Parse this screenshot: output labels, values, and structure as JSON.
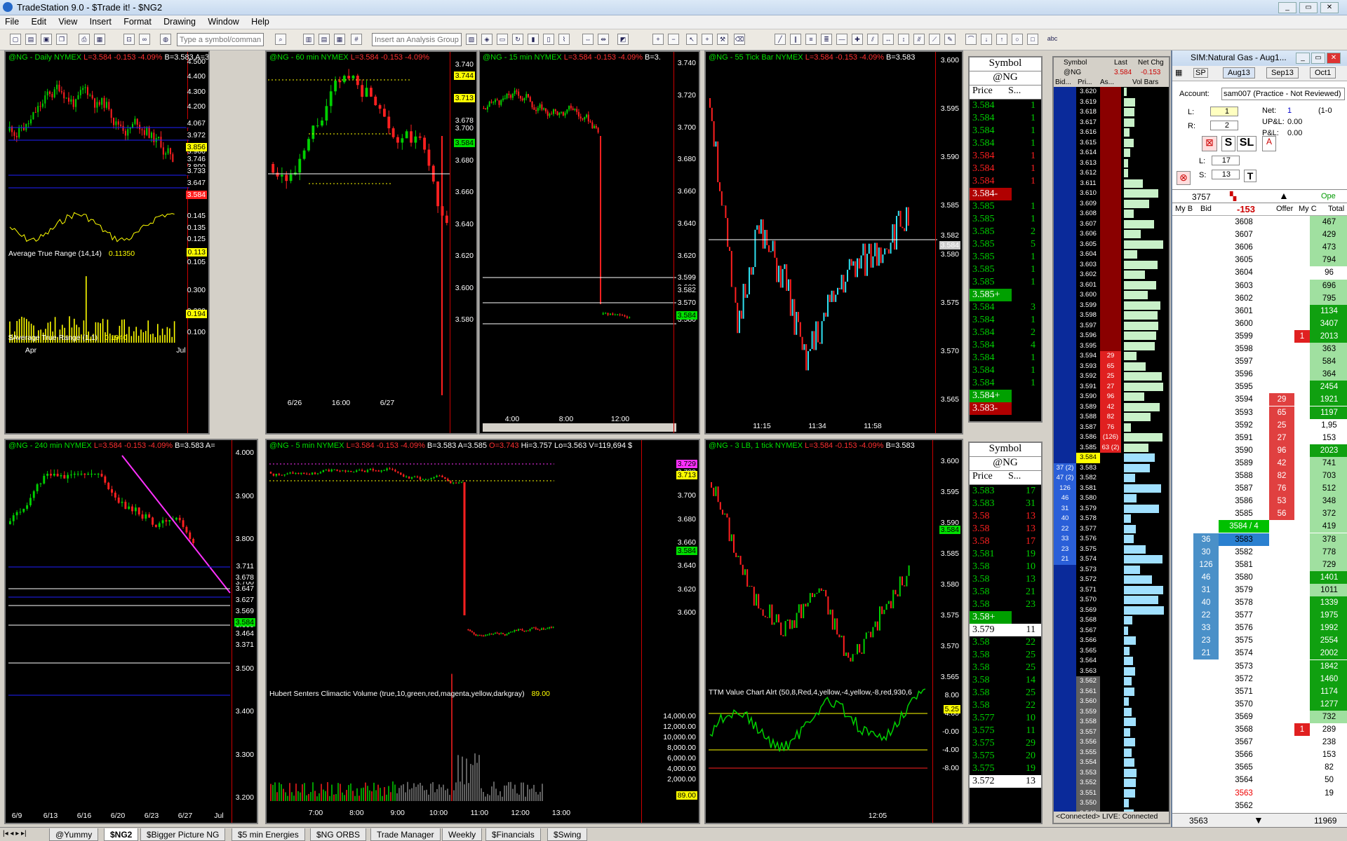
{
  "app": {
    "title": "TradeStation 9.0 - $Trade it! - $NG2"
  },
  "menu": [
    "File",
    "Edit",
    "View",
    "Insert",
    "Format",
    "Drawing",
    "Window",
    "Help"
  ],
  "toolbar": {
    "symbol_placeholder": "Type a symbol/command",
    "analysis_placeholder": "Insert an Analysis Group",
    "drawing_text": "abc"
  },
  "charts": {
    "daily": {
      "title": "@NG - Daily",
      "exchange": "NYMEX",
      "last": "L=3.584",
      "chg": "-0.153",
      "pct": "-4.09%",
      "bid": "B=3.583",
      "ask": "A=3.5",
      "ticks": [
        "4.500",
        "4.400",
        "4.300",
        "4.200",
        "4.100",
        "4.000",
        "3.900",
        "3.800",
        "3.700"
      ],
      "labels": [
        "4.067",
        "3.972",
        "3.856",
        "3.746",
        "3.733",
        "3.647",
        "3.584"
      ],
      "ind1": {
        "name": "Average True Range (14,14)",
        "value": "0.11350",
        "ticks": [
          "0.145",
          "0.135",
          "0.125",
          "0.115",
          "0.105"
        ],
        "last": "0.113"
      },
      "ind2": {
        "name": "$Average True Range (1,1)",
        "value": "0.1940",
        "ticks": [
          "0.300",
          "0.200",
          "0.100"
        ],
        "last": "0.194"
      },
      "xticks": [
        "Apr",
        "Jul"
      ]
    },
    "m60": {
      "title": "@NG - 60 min",
      "exchange": "NYMEX",
      "last": "L=3.584",
      "chg": "-0.153",
      "pct": "-4.09%",
      "ticks": [
        "3.740",
        "3.720",
        "3.700",
        "3.680",
        "3.660",
        "3.640",
        "3.620",
        "3.600",
        "3.580"
      ],
      "labels": [
        "3.744",
        "3.713",
        "3.678",
        "3.584"
      ],
      "xticks": [
        "6/26",
        "16:00",
        "6/27"
      ]
    },
    "m15": {
      "title": "@NG - 15 min",
      "exchange": "NYMEX",
      "last": "L=3.584",
      "chg": "-0.153",
      "pct": "-4.09%",
      "bid": "B=3.",
      "ticks": [
        "3.740",
        "3.720",
        "3.700",
        "3.680",
        "3.660",
        "3.640",
        "3.620",
        "3.600",
        "3.580"
      ],
      "labels": [
        "3.599",
        "3.582",
        "3.570",
        "3.584"
      ],
      "xticks": [
        "4:00",
        "8:00",
        "12:00"
      ]
    },
    "t55": {
      "title": "@NG - 55 Tick Bar",
      "exchange": "NYMEX",
      "last": "L=3.584",
      "chg": "-0.153",
      "pct": "-4.09%",
      "bid": "B=3.583",
      "ticks": [
        "3.600",
        "3.595",
        "3.590",
        "3.585",
        "3.580",
        "3.575",
        "3.570",
        "3.565"
      ],
      "labels": [
        "3.582",
        "3.584"
      ],
      "xticks": [
        "11:15",
        "11:34",
        "11:58"
      ]
    },
    "m240": {
      "title": "@NG - 240 min",
      "exchange": "NYMEX",
      "last": "L=3.584",
      "chg": "-0.153",
      "pct": "-4.09%",
      "bid": "B=3.583",
      "ask": "A=",
      "ticks": [
        "4.000",
        "3.900",
        "3.800",
        "3.700",
        "3.600",
        "3.500",
        "3.400",
        "3.300",
        "3.200"
      ],
      "labels": [
        "3.711",
        "3.678",
        "3.647",
        "3.627",
        "3.569",
        "3.584",
        "3.464",
        "3.371"
      ],
      "xticks": [
        "6/9",
        "6/13",
        "6/16",
        "6/20",
        "6/23",
        "6/27",
        "Jul"
      ]
    },
    "m5": {
      "title": "@NG - 5 min",
      "exchange": "NYMEX",
      "last": "L=3.584",
      "chg": "-0.153",
      "pct": "-4.09%",
      "bid": "B=3.583",
      "ask": "A=3.585",
      "open": "O=3.743",
      "hi": "Hi=3.757",
      "lo": "Lo=3.563",
      "vol": "V=119,694",
      "extra": "$",
      "ticks": [
        "3.720",
        "3.700",
        "3.680",
        "3.660",
        "3.640",
        "3.620",
        "3.600"
      ],
      "labels": [
        "3.729",
        "3.713",
        "3.584"
      ],
      "ind": {
        "name": "Hubert Senters Climactic Volume (true,10,green,red,magenta,yellow,darkgray)",
        "value": "89.00",
        "ticks": [
          "14,000.00",
          "12,000.00",
          "10,000.00",
          "8,000.00",
          "6,000.00",
          "4,000.00",
          "2,000.00"
        ],
        "last": "89.00"
      },
      "xticks": [
        "7:00",
        "8:00",
        "9:00",
        "10:00",
        "11:00",
        "12:00",
        "13:00"
      ]
    },
    "lb3": {
      "title": "@NG - 3 LB, 1 tick",
      "exchange": "NYMEX",
      "last": "L=3.584",
      "chg": "-0.153",
      "pct": "-4.09%",
      "bid": "B=3.583",
      "ticks": [
        "3.600",
        "3.595",
        "3.590",
        "3.585",
        "3.580",
        "3.575",
        "3.570",
        "3.565"
      ],
      "labels": [
        "3.584"
      ],
      "ind": {
        "name": "TTM Value Chart Alrt (50,8,Red,4,yellow,-4,yellow,-8,red,930,6",
        "ticks": [
          "8.00",
          "4.00",
          "-0.00",
          "-4.00",
          "-8.00"
        ],
        "last": "5.25"
      },
      "xticks": [
        "12:05"
      ]
    }
  },
  "ladder_top": {
    "symbol_label": "Symbol",
    "symbol": "@NG",
    "price_label": "Price",
    "size_label": "S...",
    "rows": [
      {
        "p": "3.584",
        "s": "1",
        "c": "g"
      },
      {
        "p": "3.584",
        "s": "1",
        "c": "g"
      },
      {
        "p": "3.584",
        "s": "1",
        "c": "g"
      },
      {
        "p": "3.584",
        "s": "1",
        "c": "g"
      },
      {
        "p": "3.584",
        "s": "1",
        "c": "r"
      },
      {
        "p": "3.584",
        "s": "1",
        "c": "r"
      },
      {
        "p": "3.584",
        "s": "1",
        "c": "r"
      },
      {
        "p": "3.584-",
        "s": "1",
        "c": "hlr"
      },
      {
        "p": "3.585",
        "s": "1",
        "c": "g"
      },
      {
        "p": "3.585",
        "s": "1",
        "c": "g"
      },
      {
        "p": "3.585",
        "s": "2",
        "c": "g"
      },
      {
        "p": "3.585",
        "s": "5",
        "c": "g"
      },
      {
        "p": "3.585",
        "s": "1",
        "c": "g"
      },
      {
        "p": "3.585",
        "s": "1",
        "c": "g"
      },
      {
        "p": "3.585",
        "s": "1",
        "c": "g"
      },
      {
        "p": "3.585+",
        "s": "1",
        "c": "hlg"
      },
      {
        "p": "3.584",
        "s": "3",
        "c": "g"
      },
      {
        "p": "3.584",
        "s": "1",
        "c": "g"
      },
      {
        "p": "3.584",
        "s": "2",
        "c": "g"
      },
      {
        "p": "3.584",
        "s": "4",
        "c": "g"
      },
      {
        "p": "3.584",
        "s": "1",
        "c": "g"
      },
      {
        "p": "3.584",
        "s": "1",
        "c": "g"
      },
      {
        "p": "3.584",
        "s": "1",
        "c": "g"
      },
      {
        "p": "3.584+",
        "s": "1",
        "c": "hlg"
      },
      {
        "p": "3.583-",
        "s": "1",
        "c": "hlr"
      }
    ]
  },
  "ladder_bot": {
    "symbol_label": "Symbol",
    "symbol": "@NG",
    "price_label": "Price",
    "size_label": "S...",
    "rows": [
      {
        "p": "3.583",
        "s": "17",
        "c": "g"
      },
      {
        "p": "3.583",
        "s": "31",
        "c": "g"
      },
      {
        "p": "3.58",
        "s": "13",
        "c": "r"
      },
      {
        "p": "3.58",
        "s": "13",
        "c": "r"
      },
      {
        "p": "3.58",
        "s": "17",
        "c": "r"
      },
      {
        "p": "3.581",
        "s": "19",
        "c": "g"
      },
      {
        "p": "3.58",
        "s": "10",
        "c": "g"
      },
      {
        "p": "3.58",
        "s": "13",
        "c": "g"
      },
      {
        "p": "3.58",
        "s": "21",
        "c": "g"
      },
      {
        "p": "3.58",
        "s": "23",
        "c": "g"
      },
      {
        "p": "3.58+",
        "s": "18",
        "c": "hlg"
      },
      {
        "p": "3.579",
        "s": "11",
        "c": "hlw"
      },
      {
        "p": "3.58",
        "s": "22",
        "c": "g"
      },
      {
        "p": "3.58",
        "s": "25",
        "c": "g"
      },
      {
        "p": "3.58",
        "s": "25",
        "c": "g"
      },
      {
        "p": "3.58",
        "s": "14",
        "c": "g"
      },
      {
        "p": "3.58",
        "s": "25",
        "c": "g"
      },
      {
        "p": "3.58",
        "s": "22",
        "c": "g"
      },
      {
        "p": "3.577",
        "s": "10",
        "c": "g"
      },
      {
        "p": "3.575",
        "s": "11",
        "c": "g"
      },
      {
        "p": "3.575",
        "s": "29",
        "c": "g"
      },
      {
        "p": "3.575",
        "s": "20",
        "c": "g"
      },
      {
        "p": "3.575",
        "s": "19",
        "c": "g"
      },
      {
        "p": "3.572",
        "s": "13",
        "c": "hlw"
      }
    ]
  },
  "volbars": {
    "headers": [
      "Symbol",
      "Last",
      "Net Chg"
    ],
    "symbol": "@NG",
    "last": "3.584",
    "chg": "-0.153",
    "sub": [
      "Bid...",
      "Pri...",
      "As...",
      "Vol Bars"
    ],
    "prices": [
      "3.620",
      "3.619",
      "3.618",
      "3.617",
      "3.616",
      "3.615",
      "3.614",
      "3.613",
      "3.612",
      "3.611",
      "3.610",
      "3.609",
      "3.608",
      "3.607",
      "3.606",
      "3.605",
      "3.604",
      "3.603",
      "3.602",
      "3.601",
      "3.600",
      "3.599",
      "3.598",
      "3.597",
      "3.596",
      "3.595",
      "3.594",
      "3.593",
      "3.592",
      "3.591",
      "3.590",
      "3.589",
      "3.588",
      "3.587",
      "3.586",
      "3.585",
      "3.584",
      "3.583",
      "3.582",
      "3.581",
      "3.580",
      "3.579",
      "3.578",
      "3.577",
      "3.576",
      "3.575",
      "3.574",
      "3.573",
      "3.572",
      "3.571",
      "3.570",
      "3.569",
      "3.568",
      "3.567",
      "3.566",
      "3.565",
      "3.564",
      "3.563",
      "3.562",
      "3.561",
      "3.560",
      "3.559",
      "3.558",
      "3.557",
      "3.556",
      "3.555",
      "3.554",
      "3.553",
      "3.552",
      "3.551",
      "3.550",
      "3.549"
    ],
    "asks": {
      "3.594": "29",
      "3.593": "65",
      "3.592": "25",
      "3.591": "27",
      "3.590": "96",
      "3.589": "42",
      "3.588": "82",
      "3.587": "76",
      "3.586": "(126)",
      "3.585": "63 (2)"
    },
    "bids": {
      "3.583": "37 (2)",
      "3.582": "47 (2)",
      "3.581": "126",
      "3.580": "46",
      "3.579": "31",
      "3.578": "40",
      "3.577": "22",
      "3.576": "33",
      "3.575": "23",
      "3.574": "21"
    },
    "status": "<Connected> LIVE: Connected"
  },
  "dom": {
    "title": "SIM:Natural Gas - Aug1...",
    "sp": "SP",
    "months": [
      "Aug13",
      "Sep13",
      "Oct1"
    ],
    "account_label": "Account:",
    "account": "sam007 (Practice - Not Reviewed)",
    "l_label": "L:",
    "l_val": "1",
    "r_label": "R:",
    "r_val": "2",
    "net_label": "Net:",
    "net": "1",
    "net2": "(1-0",
    "upl_label": "UP&L:",
    "upl": "0.00",
    "pl_label": "P&L:",
    "pl": "0.00",
    "s_btn": "S",
    "sl_btn": "SL",
    "l2_label": "L:",
    "l2": "17",
    "s2_label": "S:",
    "s2": "13",
    "t_btn": "T",
    "qty": "3757",
    "open_label": "Ope",
    "colhdr": [
      "My B",
      "Bid",
      "-153",
      "Offer",
      "My C",
      "Total"
    ],
    "rows": [
      {
        "p": "3608",
        "t": "467"
      },
      {
        "p": "3607",
        "t": "429"
      },
      {
        "p": "3606",
        "t": "473"
      },
      {
        "p": "3605",
        "t": "794"
      },
      {
        "p": "3604",
        "t": "96"
      },
      {
        "p": "3603",
        "t": "696"
      },
      {
        "p": "3602",
        "t": "795"
      },
      {
        "p": "3601",
        "t": "1134"
      },
      {
        "p": "3600",
        "t": "3407"
      },
      {
        "p": "3599",
        "t": "2013",
        "myo": "1"
      },
      {
        "p": "3598",
        "t": "363"
      },
      {
        "p": "3597",
        "t": "584"
      },
      {
        "p": "3596",
        "t": "364"
      },
      {
        "p": "3595",
        "t": "2454"
      },
      {
        "p": "3594",
        "o": "29",
        "t": "1921"
      },
      {
        "p": "3593",
        "o": "65",
        "t": "1197"
      },
      {
        "p": "3592",
        "o": "25",
        "t": "1,95"
      },
      {
        "p": "3591",
        "o": "27",
        "t": "153"
      },
      {
        "p": "3590",
        "o": "96",
        "t": "2023"
      },
      {
        "p": "3589",
        "o": "42",
        "t": "741"
      },
      {
        "p": "3588",
        "o": "82",
        "t": "703"
      },
      {
        "p": "3587",
        "o": "76",
        "t": "512"
      },
      {
        "p": "3586",
        "o": "53",
        "t": "348"
      },
      {
        "p": "3585",
        "o": "56",
        "t": "372"
      },
      {
        "p": "3584 / 4",
        "t": "419",
        "last": true
      },
      {
        "p": "3583",
        "b": "36",
        "t": "378"
      },
      {
        "p": "3582",
        "b": "30",
        "t": "778"
      },
      {
        "p": "3581",
        "b": "126",
        "t": "729"
      },
      {
        "p": "3580",
        "b": "46",
        "t": "1401"
      },
      {
        "p": "3579",
        "b": "31",
        "t": "1011"
      },
      {
        "p": "3578",
        "b": "40",
        "t": "1339"
      },
      {
        "p": "3577",
        "b": "22",
        "t": "1975"
      },
      {
        "p": "3576",
        "b": "33",
        "t": "1992"
      },
      {
        "p": "3575",
        "b": "23",
        "t": "2554"
      },
      {
        "p": "3574",
        "b": "21",
        "t": "2002"
      },
      {
        "p": "3573",
        "t": "1842"
      },
      {
        "p": "3572",
        "t": "1460"
      },
      {
        "p": "3571",
        "t": "1174"
      },
      {
        "p": "3570",
        "t": "1277"
      },
      {
        "p": "3569",
        "t": "732"
      },
      {
        "p": "3568",
        "t": "289",
        "myb": "1"
      },
      {
        "p": "3567",
        "t": "238"
      },
      {
        "p": "3566",
        "t": "153"
      },
      {
        "p": "3565",
        "t": "82"
      },
      {
        "p": "3564",
        "t": "50"
      },
      {
        "p": "3563",
        "t": "19",
        "red": true
      },
      {
        "p": "3562",
        "t": ""
      }
    ],
    "bottom_price": "3563",
    "bottom_total": "11969"
  },
  "tabs": [
    "@Yummy",
    "$NG2",
    "$Bigger Picture NG",
    "$5 min Energies",
    "$NG ORBS",
    "Trade Manager",
    "Weekly",
    "$Financials",
    "$Swing"
  ],
  "colors": {
    "up": "#00d000",
    "down": "#ff2020",
    "cyan": "#30e0f0",
    "yellow": "#ffff00",
    "magenta": "#ff30ff",
    "blue": "#2020ff"
  }
}
